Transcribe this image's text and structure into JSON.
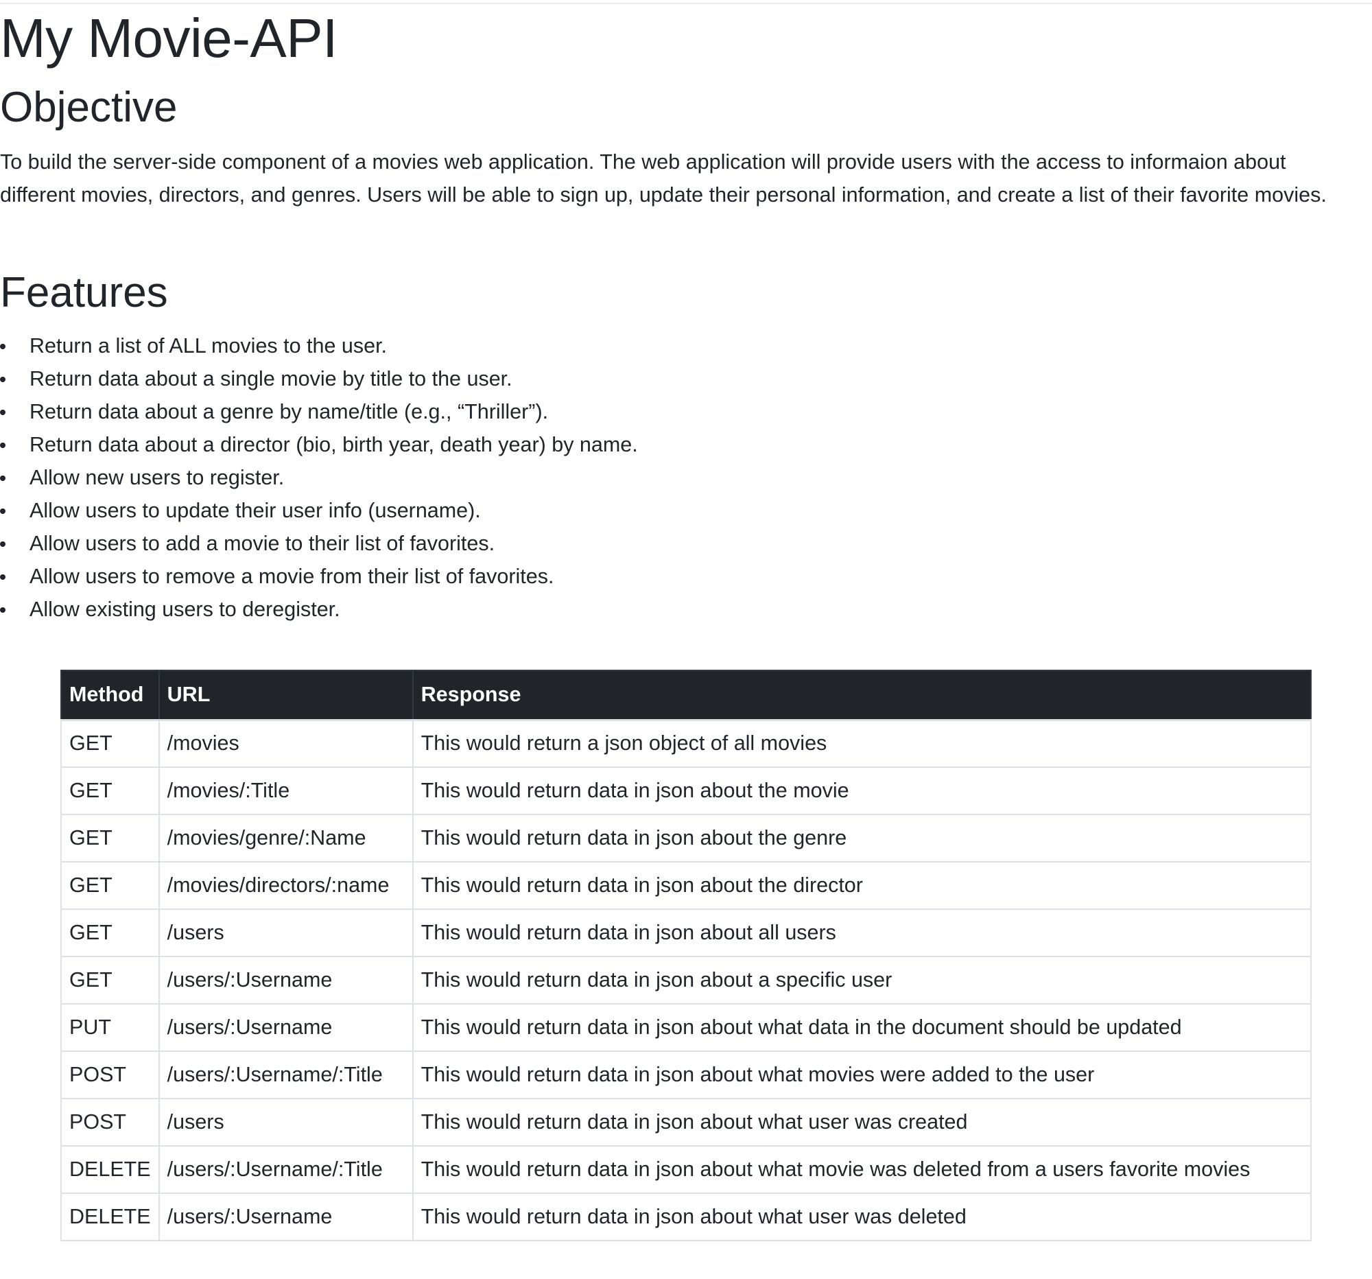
{
  "page": {
    "title": "My Movie-API",
    "objective": {
      "heading": "Objective",
      "text": "To build the server-side component of a movies web application. The web application will provide users with the access to informaion about different movies, directors, and genres. Users will be able to sign up, update their personal information, and create a list of their favorite movies."
    },
    "features": {
      "heading": "Features",
      "items": [
        "Return a list of ALL movies to the user.",
        "Return data about a single movie by title to the user.",
        "Return data about a genre by name/title (e.g., “Thriller”).",
        "Return data about a director (bio, birth year, death year) by name.",
        "Allow new users to register.",
        "Allow users to update their user info (username).",
        "Allow users to add a movie to their list of favorites.",
        "Allow users to remove a movie from their list of favorites.",
        "Allow existing users to deregister."
      ]
    }
  },
  "table": {
    "headers": [
      "Method",
      "URL",
      "Response"
    ],
    "rows": [
      [
        "GET",
        "/movies",
        "This would return a json object of all movies"
      ],
      [
        "GET",
        "/movies/:Title",
        "This would return data in json about the movie"
      ],
      [
        "GET",
        "/movies/genre/:Name",
        "This would return data in json about the genre"
      ],
      [
        "GET",
        "/movies/directors/:name",
        "This would return data in json about the director"
      ],
      [
        "GET",
        "/users",
        "This would return data in json about all users"
      ],
      [
        "GET",
        "/users/:Username",
        "This would return data in json about a specific user"
      ],
      [
        "PUT",
        "/users/:Username",
        "This would return data in json about what data in the document should be updated"
      ],
      [
        "POST",
        "/users/:Username/:Title",
        "This would return data in json about what movies were added to the user"
      ],
      [
        "POST",
        "/users",
        "This would return data in json about what user was created"
      ],
      [
        "DELETE",
        "/users/:Username/:Title",
        "This would return data in json about what movie was deleted from a users favorite movies"
      ],
      [
        "DELETE",
        "/users/:Username",
        "This would return data in json about what user was deleted"
      ]
    ]
  },
  "colors": {
    "text": "#212529",
    "table_header_bg": "#212529",
    "table_border": "#dee2e6"
  }
}
